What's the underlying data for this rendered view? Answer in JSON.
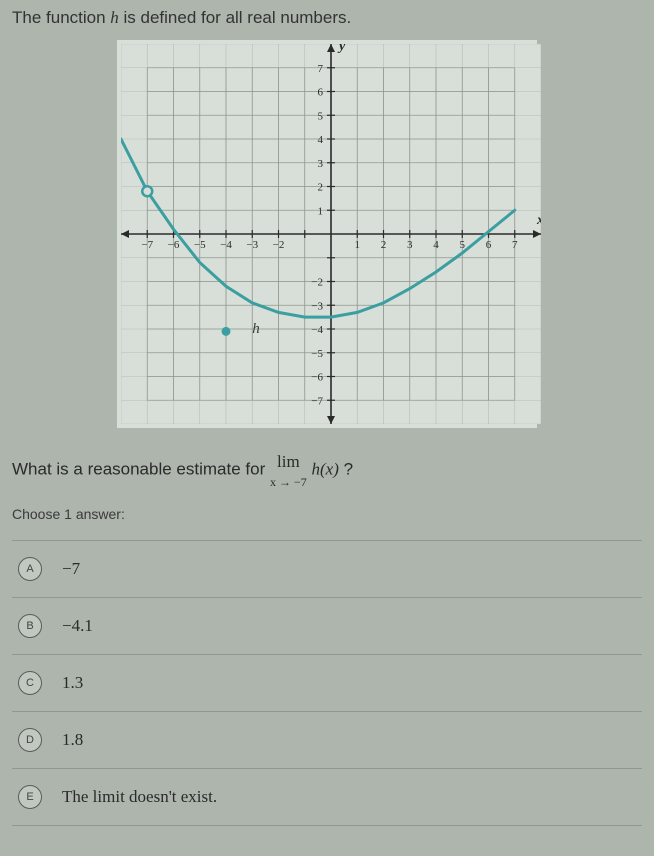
{
  "prompt_prefix": "The function ",
  "prompt_func": "h",
  "prompt_suffix": " is defined for all real numbers.",
  "question_prefix": "What is a reasonable estimate for ",
  "question_lim": "lim",
  "question_lim_sub": "x → −7",
  "question_hx": "h(x)",
  "question_qmark": " ?",
  "choose_label": "Choose 1 answer:",
  "answers": [
    {
      "letter": "A",
      "text": "−7"
    },
    {
      "letter": "B",
      "text": "−4.1"
    },
    {
      "letter": "C",
      "text": "1.3"
    },
    {
      "letter": "D",
      "text": "1.8"
    },
    {
      "letter": "E",
      "text": "The limit doesn't exist."
    }
  ],
  "chart_data": {
    "type": "line",
    "title": "",
    "xlabel": "x",
    "ylabel": "y",
    "xlim": [
      -8,
      8
    ],
    "ylim": [
      -8,
      8
    ],
    "x_ticks": [
      -7,
      -6,
      -5,
      -4,
      -3,
      -2,
      -1,
      0,
      1,
      2,
      3,
      4,
      5,
      6,
      7
    ],
    "y_ticks": [
      -7,
      -6,
      -5,
      -4,
      -3,
      -2,
      -1,
      0,
      1,
      2,
      3,
      4,
      5,
      6,
      7
    ],
    "series": [
      {
        "name": "h",
        "color": "#3b9ea0",
        "points": [
          {
            "x": -8,
            "y": 4.0
          },
          {
            "x": -7,
            "y": 1.8
          },
          {
            "x": -6,
            "y": 0.2
          },
          {
            "x": -5,
            "y": -1.2
          },
          {
            "x": -4,
            "y": -2.2
          },
          {
            "x": -3,
            "y": -2.9
          },
          {
            "x": -2,
            "y": -3.3
          },
          {
            "x": -1,
            "y": -3.5
          },
          {
            "x": 0,
            "y": -3.5
          },
          {
            "x": 1,
            "y": -3.3
          },
          {
            "x": 2,
            "y": -2.9
          },
          {
            "x": 3,
            "y": -2.3
          },
          {
            "x": 4,
            "y": -1.6
          },
          {
            "x": 5,
            "y": -0.8
          },
          {
            "x": 6,
            "y": 0.1
          },
          {
            "x": 7,
            "y": 1.0
          }
        ]
      }
    ],
    "open_point": {
      "x": -7,
      "y": 1.8
    },
    "closed_point": {
      "x": -4,
      "y": -4.1
    },
    "legend_label": "h"
  }
}
